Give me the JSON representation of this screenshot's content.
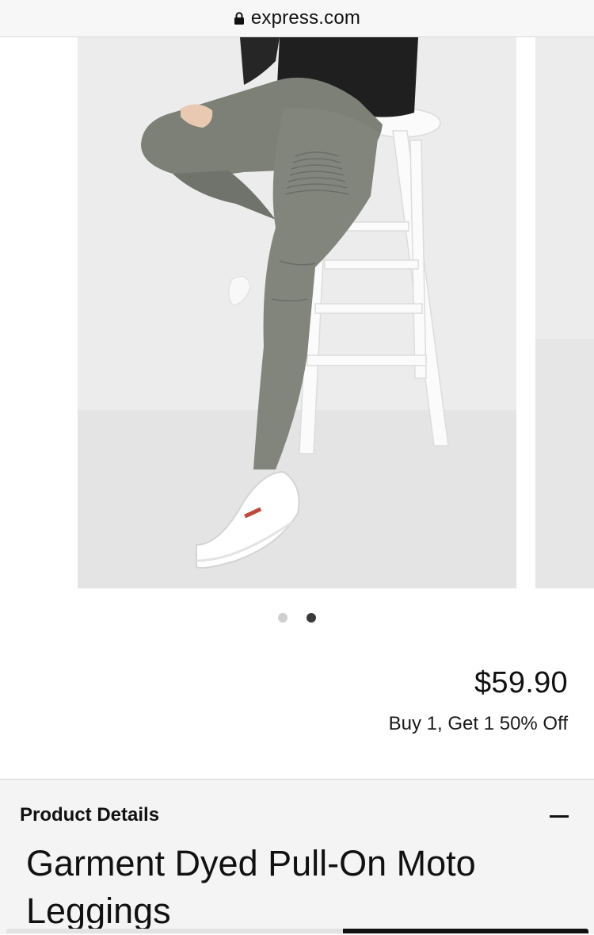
{
  "browser": {
    "url": "express.com",
    "lock_icon": "lock-icon"
  },
  "carousel": {
    "slide_count": 2,
    "active_index": 2
  },
  "product": {
    "price": "$59.90",
    "promotion": "Buy 1, Get 1 50% Off",
    "details_label": "Product Details",
    "collapse_icon": "minus-icon",
    "name": "Garment Dyed Pull-On Moto Leggings"
  },
  "colors": {
    "legging_gray": "#7c8077",
    "background": "#ececec",
    "active_dot": "#3a3a3a",
    "inactive_dot": "#cfcfcf"
  }
}
